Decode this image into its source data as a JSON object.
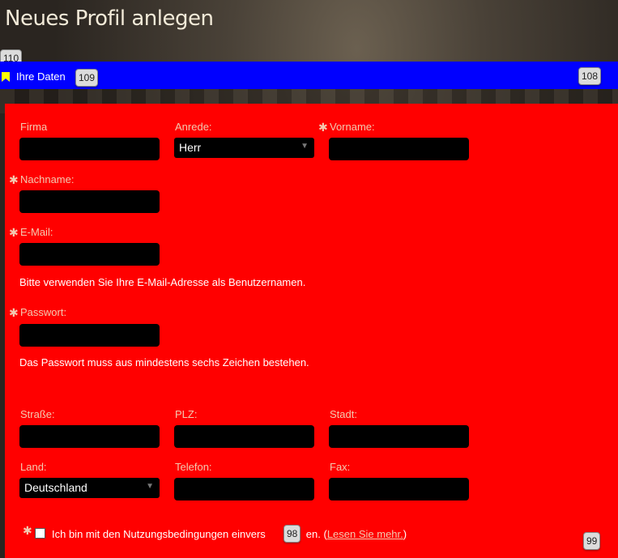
{
  "page": {
    "title": "Neues Profil anlegen"
  },
  "badges": {
    "b110": "110",
    "b109": "109",
    "b108": "108",
    "b98": "98",
    "b99": "99"
  },
  "section": {
    "title": "Ihre Daten"
  },
  "form": {
    "firma_label": "Firma",
    "anrede_label": "Anrede:",
    "anrede_value": "Herr",
    "vorname_label": "Vorname:",
    "nachname_label": "Nachname:",
    "email_label": "E-Mail:",
    "email_hint": "Bitte verwenden Sie Ihre E-Mail-Adresse als Benutzernamen.",
    "passwort_label": "Passwort:",
    "passwort_hint": "Das Passwort muss aus mindestens sechs Zeichen bestehen.",
    "strasse_label": "Straße:",
    "plz_label": "PLZ:",
    "stadt_label": "Stadt:",
    "land_label": "Land:",
    "land_value": "Deutschland",
    "telefon_label": "Telefon:",
    "fax_label": "Fax:",
    "required_marker": "✱",
    "agree_text_1": "Ich bin mit den Nutzungsbedingungen einvers",
    "agree_text_2": "en. (",
    "agree_link": "Lesen Sie mehr.",
    "agree_text_3": ")"
  },
  "colors": {
    "bar": "#0000ff",
    "panel": "#ff0000",
    "field": "#000000",
    "label": "#f3c9b0"
  }
}
